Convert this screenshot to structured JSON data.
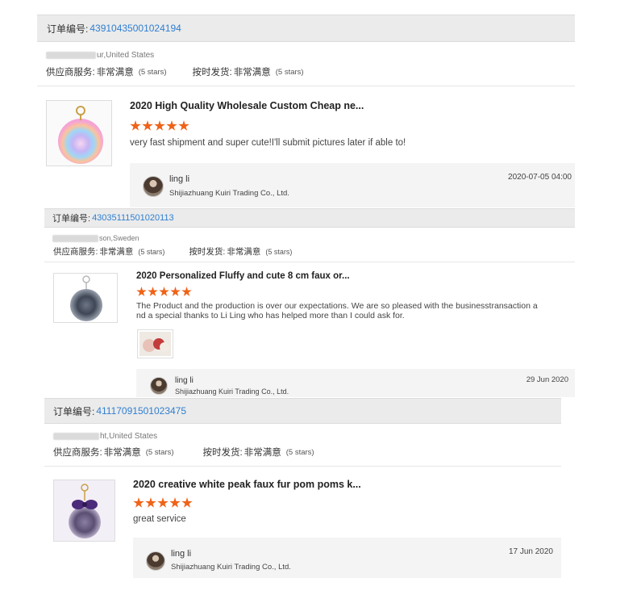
{
  "orders": [
    {
      "order_label": "订单编号:",
      "order_number": "43910435001024194",
      "buyer_location": "ur,United States",
      "supplier_service_label": "供应商服务:",
      "supplier_service_value": "非常满意",
      "supplier_service_stars": "(5 stars)",
      "shipping_label": "按时发货:",
      "shipping_value": "非常满意",
      "shipping_stars": "(5 stars)",
      "product_title": "2020 High Quality Wholesale Custom Cheap ne...",
      "rating": 5,
      "review_text": "very fast shipment and super cute!I'll submit pictures later if able to!",
      "reply_name": "ling li",
      "reply_company": "Shijiazhuang Kuiri Trading Co., Ltd.",
      "reply_date": "2020-07-05 04:00"
    },
    {
      "order_label": "订单编号:",
      "order_number": "43035111501020113",
      "buyer_location": "son,Sweden",
      "supplier_service_label": "供应商服务:",
      "supplier_service_value": "非常满意",
      "supplier_service_stars": "(5 stars)",
      "shipping_label": "按时发货:",
      "shipping_value": "非常满意",
      "shipping_stars": "(5 stars)",
      "product_title": "2020 Personalized Fluffy and cute 8 cm faux or...",
      "rating": 5,
      "review_text_line1": "The Product and the production is over our expectations. We are so pleased with the businesstransaction a",
      "review_text_line2": "nd a special thanks to Li Ling who has helped more than I could ask for.",
      "reply_name": "ling li",
      "reply_company": "Shijiazhuang Kuiri Trading Co., Ltd.",
      "reply_date": "29 Jun 2020"
    },
    {
      "order_label": "订单编号:",
      "order_number": "41117091501023475",
      "buyer_location": "ht,United States",
      "supplier_service_label": "供应商服务:",
      "supplier_service_value": "非常满意",
      "supplier_service_stars": "(5 stars)",
      "shipping_label": "按时发货:",
      "shipping_value": "非常满意",
      "shipping_stars": "(5 stars)",
      "product_title": "2020 creative white peak faux fur pom poms k...",
      "rating": 5,
      "review_text": "great service",
      "reply_name": "ling li",
      "reply_company": "Shijiazhuang Kuiri Trading Co., Ltd.",
      "reply_date": "17 Jun 2020"
    }
  ],
  "colors": {
    "accent_link": "#2f7fd1",
    "star": "#f06217",
    "header_bg": "#ebebeb",
    "reply_bg": "#f4f4f4"
  },
  "icons": [
    "star-icon",
    "avatar",
    "product-thumbnail"
  ]
}
